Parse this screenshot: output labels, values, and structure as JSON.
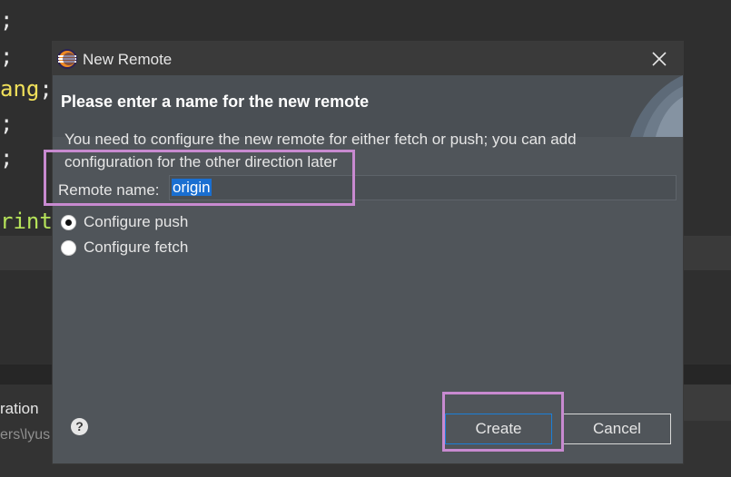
{
  "background": {
    "code_lines": [
      {
        "text": ";",
        "class": ""
      },
      {
        "text": ";",
        "class": ""
      },
      {
        "text": "ang",
        "tail": ";",
        "class": "kw-yellow"
      },
      {
        "text": ";",
        "class": ""
      },
      {
        "text": ";",
        "class": ""
      },
      {
        "text": "rint",
        "class": "kw-green"
      }
    ],
    "panel_tab": "ration",
    "path_text": "ers\\lyus"
  },
  "dialog": {
    "title": "New Remote",
    "banner_title": "Please enter a name for the new remote",
    "description": "You need to configure the new remote for either fetch or push; you can add configuration for the other direction later",
    "remote_name_label": "Remote name:",
    "remote_name_value": "origin",
    "options": [
      {
        "label": "Configure push",
        "checked": true
      },
      {
        "label": "Configure fetch",
        "checked": false
      }
    ],
    "create_label": "Create",
    "cancel_label": "Cancel",
    "help_icon": "?"
  },
  "colors": {
    "highlight": "#c88ad0",
    "selection": "#1a6fd1",
    "dialog_bg": "#50555a"
  }
}
